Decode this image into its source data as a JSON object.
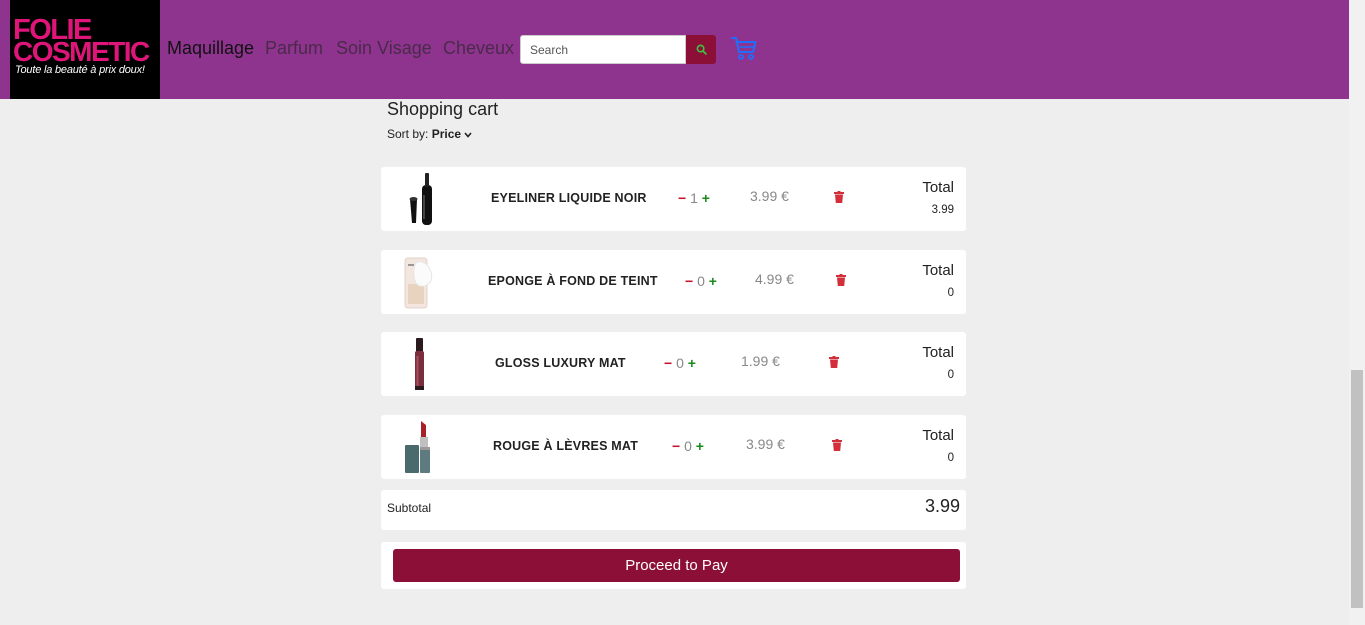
{
  "brand": {
    "line1": "FOLIE",
    "line2": "COSMETIC",
    "tagline": "Toute la beauté à prix doux!"
  },
  "nav": {
    "links": [
      "Maquillage",
      "Parfum",
      "Soin Visage",
      "Cheveux"
    ],
    "active": "Maquillage"
  },
  "search": {
    "placeholder": "Search",
    "value": ""
  },
  "icons": {
    "search": "search-icon",
    "cart": "shopping-cart-icon",
    "delete": "trash-icon"
  },
  "colors": {
    "navbar": "#8e348e",
    "brand_pink": "#e0157a",
    "accent": "#8b0f36",
    "remove": "#c8102e",
    "add": "#1a8a1a",
    "cart_icon": "#1e6fff"
  },
  "cart": {
    "title": "Shopping cart",
    "sort_label": "Sort by:",
    "sort_value": "Price",
    "total_label": "Total",
    "items": [
      {
        "name": "EYELINER LIQUIDE NOIR",
        "minus": "−",
        "qty": "1",
        "plus": "+",
        "price": "3.99 €",
        "total": "3.99"
      },
      {
        "name": "EPONGE À FOND DE TEINT",
        "minus": "−",
        "qty": "0",
        "plus": "+",
        "price": "4.99 €",
        "total": "0"
      },
      {
        "name": "GLOSS LUXURY MAT",
        "minus": "−",
        "qty": "0",
        "plus": "+",
        "price": "1.99 €",
        "total": "0"
      },
      {
        "name": "ROUGE À LÈVRES MAT",
        "minus": "−",
        "qty": "0",
        "plus": "+",
        "price": "3.99 €",
        "total": "0"
      }
    ],
    "subtotal_label": "Subtotal",
    "subtotal_value": "3.99",
    "pay_label": "Proceed to Pay"
  }
}
